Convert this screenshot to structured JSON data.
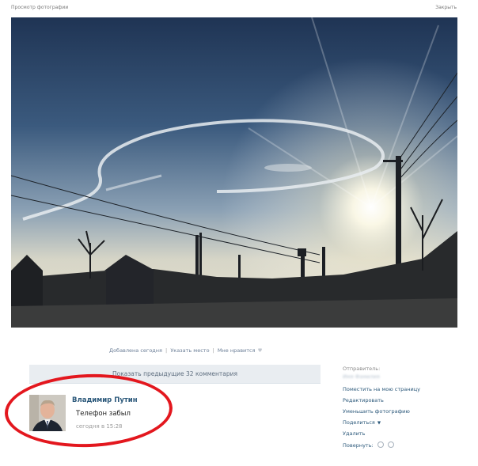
{
  "topbar": {
    "title": "Просмотр фотографии",
    "close": "Закрыть"
  },
  "photo_meta": {
    "added": "Добавлена сегодня",
    "place": "Указать место",
    "like": "Мне нравится"
  },
  "comments": {
    "show_previous": "Показать предыдущие 32 комментария",
    "items": [
      {
        "author": "Владимир Путин",
        "text": "Телефон забыл",
        "time": "сегодня в 15:28"
      }
    ]
  },
  "sidebar": {
    "sender_label": "Отправитель:",
    "sender_name": "Имя Фамилия",
    "actions": {
      "to_my_page": "Поместить на мою страницу",
      "edit": "Редактировать",
      "shrink": "Уменьшить фотографию",
      "share": "Поделиться",
      "delete": "Удалить",
      "rotate": "Повернуть:"
    }
  },
  "colors": {
    "link": "#2b587a",
    "ring": "#e3171e",
    "bar": "#e9edf1"
  }
}
